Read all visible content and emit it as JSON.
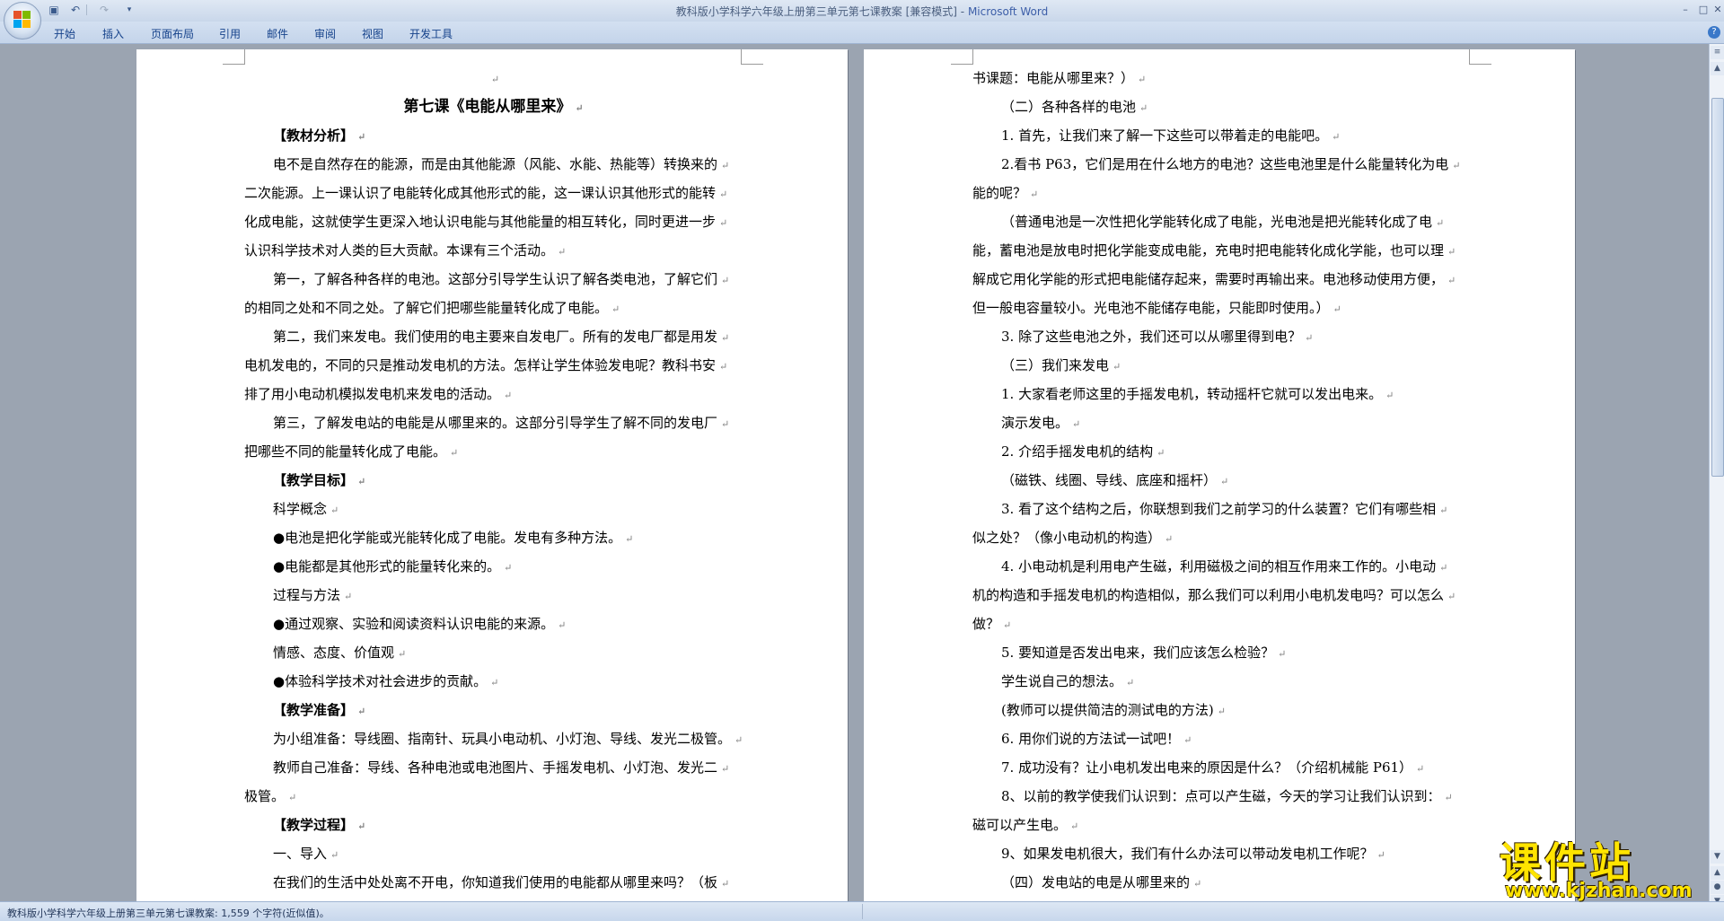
{
  "window": {
    "title_doc": "教科版小学科学六年级上册第三单元第七课教案 [兼容模式]",
    "title_sep": " - ",
    "title_app": "Microsoft Word"
  },
  "quick_access": {
    "save_icon": "save-icon",
    "undo_icon": "undo-icon",
    "redo_icon": "redo-icon"
  },
  "ribbon": {
    "tabs": [
      "开始",
      "插入",
      "页面布局",
      "引用",
      "邮件",
      "审阅",
      "视图",
      "开发工具"
    ]
  },
  "left_page": [
    {
      "text": "",
      "style": "center"
    },
    {
      "text": "第七课《电能从哪里来》",
      "style": "title"
    },
    {
      "text": "【教材分析】",
      "style": "head"
    },
    {
      "text": "电不是自然存在的能源，而是由其他能源（风能、水能、热能等）转换来的",
      "style": "ind"
    },
    {
      "text": "二次能源。上一课认识了电能转化成其他形式的能，这一课认识其他形式的能转",
      "style": ""
    },
    {
      "text": "化成电能，这就使学生更深入地认识电能与其他能量的相互转化，同时更进一步",
      "style": ""
    },
    {
      "text": "认识科学技术对人类的巨大贡献。本课有三个活动。",
      "style": ""
    },
    {
      "text": "第一，了解各种各样的电池。这部分引导学生认识了解各类电池，了解它们",
      "style": "ind"
    },
    {
      "text": "的相同之处和不同之处。了解它们把哪些能量转化成了电能。",
      "style": ""
    },
    {
      "text": "第二，我们来发电。我们使用的电主要来自发电厂。所有的发电厂都是用发",
      "style": "ind"
    },
    {
      "text": "电机发电的，不同的只是推动发电机的方法。怎样让学生体验发电呢？教科书安",
      "style": ""
    },
    {
      "text": "排了用小电动机模拟发电机来发电的活动。",
      "style": ""
    },
    {
      "text": "第三，了解发电站的电能是从哪里来的。这部分引导学生了解不同的发电厂",
      "style": "ind"
    },
    {
      "text": "把哪些不同的能量转化成了电能。",
      "style": ""
    },
    {
      "text": "【教学目标】",
      "style": "head"
    },
    {
      "text": "科学概念",
      "style": "ind"
    },
    {
      "text": "●电池是把化学能或光能转化成了电能。发电有多种方法。",
      "style": "ind"
    },
    {
      "text": "●电能都是其他形式的能量转化来的。",
      "style": "ind"
    },
    {
      "text": "过程与方法",
      "style": "ind"
    },
    {
      "text": "●通过观察、实验和阅读资料认识电能的来源。",
      "style": "ind"
    },
    {
      "text": "情感、态度、价值观",
      "style": "ind"
    },
    {
      "text": "●体验科学技术对社会进步的贡献。",
      "style": "ind"
    },
    {
      "text": "【教学准备】",
      "style": "head"
    },
    {
      "text": "为小组准备：导线圈、指南针、玩具小电动机、小灯泡、导线、发光二极管。",
      "style": "ind"
    },
    {
      "text": "教师自己准备：导线、各种电池或电池图片、手摇发电机、小灯泡、发光二",
      "style": "ind"
    },
    {
      "text": "极管。",
      "style": ""
    },
    {
      "text": "【教学过程】",
      "style": "head"
    },
    {
      "text": "一、导入",
      "style": "ind"
    },
    {
      "text": "在我们的生活中处处离不开电，你知道我们使用的电能都从哪里来吗？（板",
      "style": "ind"
    }
  ],
  "right_page": [
    {
      "text": "书课题：电能从哪里来？）",
      "style": ""
    },
    {
      "text": "（二）各种各样的电池",
      "style": "ind"
    },
    {
      "text": "1. 首先，让我们来了解一下这些可以带着走的电能吧。",
      "style": "ind"
    },
    {
      "text": "2.看书 P63，它们是用在什么地方的电池？这些电池里是什么能量转化为电",
      "style": "ind"
    },
    {
      "text": "能的呢？",
      "style": ""
    },
    {
      "text": "（普通电池是一次性把化学能转化成了电能，光电池是把光能转化成了电",
      "style": "ind"
    },
    {
      "text": "能，蓄电池是放电时把化学能变成电能，充电时把电能转化成化学能，也可以理",
      "style": ""
    },
    {
      "text": "解成它用化学能的形式把电能储存起来，需要时再输出来。电池移动使用方便，",
      "style": ""
    },
    {
      "text": "但一般电容量较小。光电池不能储存电能，只能即时使用。）",
      "style": ""
    },
    {
      "text": "3. 除了这些电池之外，我们还可以从哪里得到电？",
      "style": "ind"
    },
    {
      "text": "（三）我们来发电",
      "style": "ind"
    },
    {
      "text": "1. 大家看老师这里的手摇发电机，转动摇杆它就可以发出电来。",
      "style": "ind"
    },
    {
      "text": "演示发电。",
      "style": "ind"
    },
    {
      "text": "2. 介绍手摇发电机的结构",
      "style": "ind"
    },
    {
      "text": "（磁铁、线圈、导线、底座和摇杆）",
      "style": "ind"
    },
    {
      "text": "3. 看了这个结构之后，你联想到我们之前学习的什么装置？它们有哪些相",
      "style": "ind"
    },
    {
      "text": "似之处？（像小电动机的构造）",
      "style": ""
    },
    {
      "text": "4. 小电动机是利用电产生磁，利用磁极之间的相互作用来工作的。小电动",
      "style": "ind"
    },
    {
      "text": "机的构造和手摇发电机的构造相似，那么我们可以利用小电机发电吗？可以怎么",
      "style": ""
    },
    {
      "text": "做？",
      "style": ""
    },
    {
      "text": "5. 要知道是否发出电来，我们应该怎么检验？",
      "style": "ind"
    },
    {
      "text": "学生说自己的想法。",
      "style": "ind"
    },
    {
      "text": "(教师可以提供简洁的测试电的方法)",
      "style": "ind"
    },
    {
      "text": "6. 用你们说的方法试一试吧！",
      "style": "ind"
    },
    {
      "text": "7. 成功没有？让小电机发出电来的原因是什么？（介绍机械能 P61）",
      "style": "ind"
    },
    {
      "text": "8、以前的教学使我们认识到：点可以产生磁，今天的学习让我们认识到：",
      "style": "ind"
    },
    {
      "text": "磁可以产生电。",
      "style": ""
    },
    {
      "text": "9、如果发电机很大，我们有什么办法可以带动发电机工作呢？",
      "style": "ind"
    },
    {
      "text": "（四）发电站的电是从哪里来的",
      "style": "ind"
    }
  ],
  "status_bar": {
    "text": "教科版小学科学六年级上册第三单元第七课教案: 1,559 个字符(近似值)。"
  },
  "watermark": {
    "cn": "课件站",
    "url": "www.kjzhan.com"
  }
}
